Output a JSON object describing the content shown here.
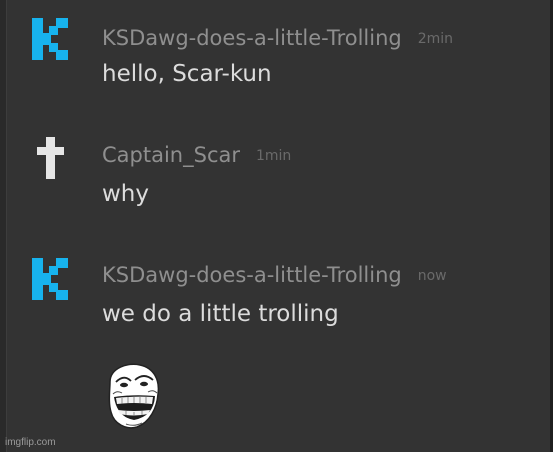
{
  "colors": {
    "background": "#333333",
    "kick_logo": "#17b3ee",
    "cross_icon": "#e6e6e6",
    "username": "#8f8f8f",
    "message_text": "#dcdcdc",
    "timestamp": "#6a6a6a"
  },
  "messages": [
    {
      "username": "KSDawg-does-a-little-Trolling",
      "timestamp": "2min",
      "text": "hello, Scar-kun",
      "avatar_icon": "kick-logo-icon"
    },
    {
      "username": "Captain_Scar",
      "timestamp": "1min",
      "text": "why",
      "avatar_icon": "cross-icon"
    },
    {
      "username": "KSDawg-does-a-little-Trolling",
      "timestamp": "now",
      "text": "we do a little trolling",
      "avatar_icon": "kick-logo-icon",
      "attachment_icon": "trollface-icon"
    }
  ],
  "watermark": "imgflip.com"
}
